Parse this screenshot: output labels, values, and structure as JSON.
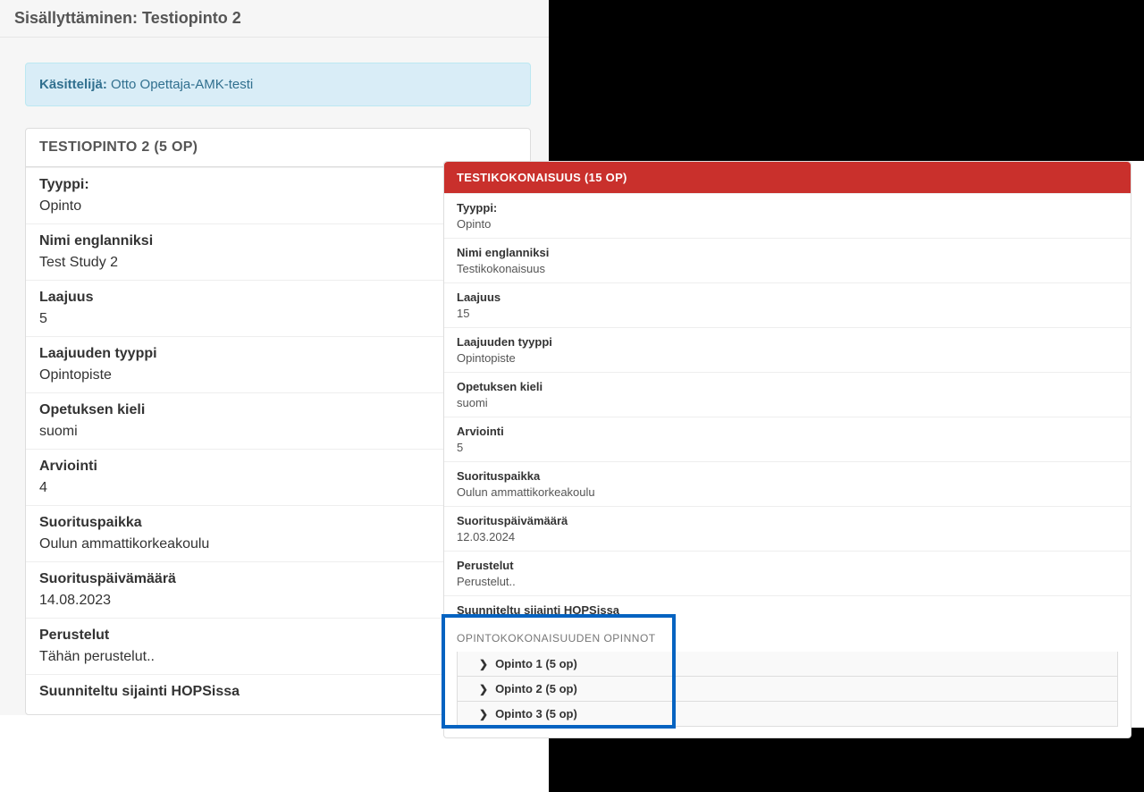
{
  "left": {
    "title_prefix": "Sisällyttäminen: ",
    "title_name": "Testiopinto 2",
    "handler_label": "Käsittelijä:",
    "handler_name": "Otto Opettaja-AMK-testi",
    "card_header": "TESTIOPINTO 2 (5 OP)",
    "fields": [
      {
        "label": "Tyyppi:",
        "value": "Opinto"
      },
      {
        "label": "Nimi englanniksi",
        "value": "Test Study 2"
      },
      {
        "label": "Laajuus",
        "value": "5"
      },
      {
        "label": "Laajuuden tyyppi",
        "value": "Opintopiste"
      },
      {
        "label": "Opetuksen kieli",
        "value": "suomi"
      },
      {
        "label": "Arviointi",
        "value": "4"
      },
      {
        "label": "Suorituspaikka",
        "value": "Oulun ammattikorkeakoulu"
      },
      {
        "label": "Suorituspäivämäärä",
        "value": "14.08.2023"
      },
      {
        "label": "Perustelut",
        "value": "Tähän perustelut.."
      },
      {
        "label": "Suunniteltu sijainti HOPSissa",
        "value": ""
      }
    ]
  },
  "right": {
    "card_header": "TESTIKOKONAISUUS (15 OP)",
    "fields": [
      {
        "label": "Tyyppi:",
        "value": "Opinto"
      },
      {
        "label": "Nimi englanniksi",
        "value": "Testikokonaisuus"
      },
      {
        "label": "Laajuus",
        "value": "15"
      },
      {
        "label": "Laajuuden tyyppi",
        "value": "Opintopiste"
      },
      {
        "label": "Opetuksen kieli",
        "value": "suomi"
      },
      {
        "label": "Arviointi",
        "value": "5"
      },
      {
        "label": "Suorituspaikka",
        "value": "Oulun ammattikorkeakoulu"
      },
      {
        "label": "Suorituspäivämäärä",
        "value": "12.03.2024"
      },
      {
        "label": "Perustelut",
        "value": "Perustelut.."
      },
      {
        "label": "Suunniteltu sijainti HOPSissa",
        "value": ""
      }
    ],
    "sub_title": "OPINTOKOKONAISUUDEN OPINNOT",
    "opinnot": [
      {
        "label": "Opinto 1 (5 op)"
      },
      {
        "label": "Opinto 2 (5 op)"
      },
      {
        "label": "Opinto 3 (5 op)"
      }
    ]
  }
}
